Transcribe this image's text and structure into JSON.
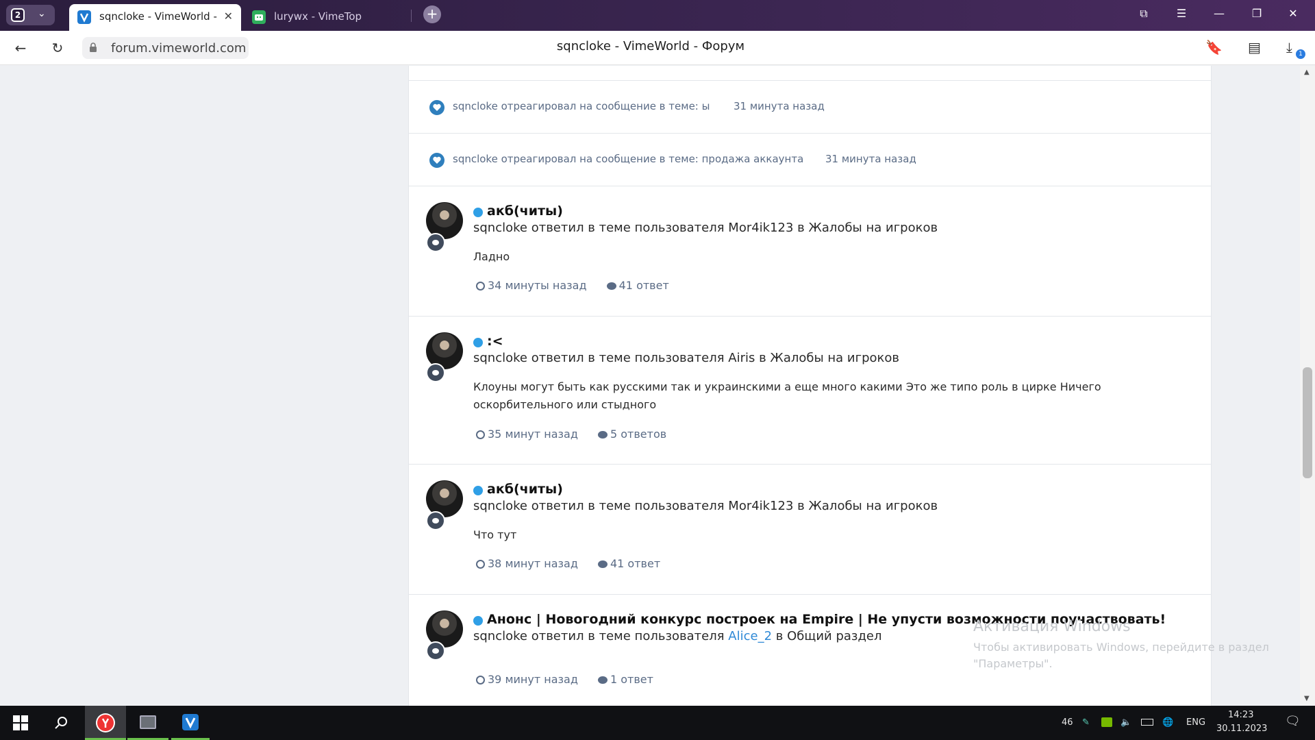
{
  "browser": {
    "tab_count": "2",
    "tabs": [
      {
        "title": "sqncloke - VimeWorld -"
      },
      {
        "title": "lurywx - VimeTop"
      }
    ],
    "url": "forum.vimeworld.com",
    "page_title": "sqncloke - VimeWorld - Форум",
    "download_badge": "1"
  },
  "reactions": [
    {
      "text": "sqncloke отреагировал на сообщение в теме: ы",
      "time": "31 минута назад"
    },
    {
      "text": "sqncloke отреагировал на сообщение в теме: продажа аккаунта",
      "time": "31 минута назад"
    }
  ],
  "posts": [
    {
      "title": "акб(читы)",
      "line": "sqncloke ответил в теме пользователя Mor4ik123 в Жалобы на игроков",
      "body": "Ладно",
      "time": "34 минуты назад",
      "replies": "41 ответ"
    },
    {
      "title": ":<",
      "line": "sqncloke ответил в теме пользователя Airis в Жалобы на игроков",
      "body": "Клоуны могут быть как русскими так и украинскими а еще много какими Это же типо роль в цирке Ничего оскорбительного или стыдного",
      "time": "35 минут назад",
      "replies": "5 ответов"
    },
    {
      "title": "акб(читы)",
      "line": "sqncloke ответил в теме пользователя Mor4ik123 в Жалобы на игроков",
      "body": "Что тут",
      "time": "38 минут назад",
      "replies": "41 ответ"
    },
    {
      "title": "Анонс | Новогодний конкурс построек на Empire | Не упусти возможности поучаствовать!",
      "line_pre": "sqncloke ответил в теме пользователя ",
      "line_link": "Alice_2",
      "line_post": " в Общий раздел",
      "time": "39 минут назад",
      "replies": "1 ответ"
    }
  ],
  "watermark": {
    "title": "Активация Windows",
    "text": "Чтобы активировать Windows, перейдите в раздел \"Параметры\"."
  },
  "taskbar": {
    "tray_number": "46",
    "lang": "ENG",
    "time": "14:23",
    "date": "30.11.2023"
  },
  "colors": {
    "online_dot": "#2f9fe6",
    "link": "#2f89d6",
    "meta": "#5a6b85",
    "heart": "#2f7fbd"
  }
}
